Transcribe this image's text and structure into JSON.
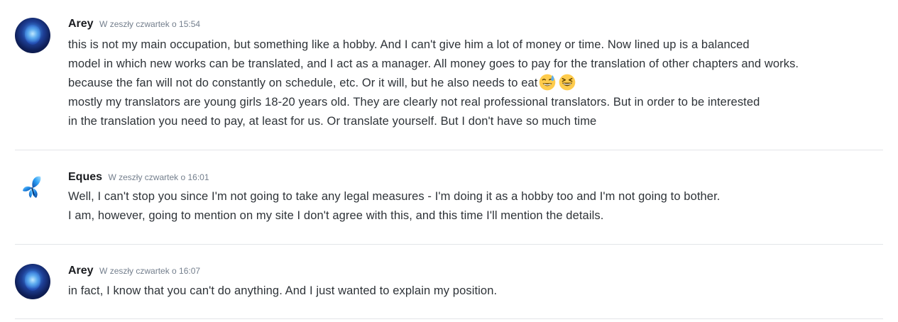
{
  "messages": [
    {
      "username": "Arey",
      "timestamp": "W zeszły czwartek o 15:54",
      "avatar_icon": "nebula-portrait-avatar",
      "lines": [
        "this is not my main occupation, but something like a hobby.  And I can't give him a lot of money or time.  Now lined up is a balanced",
        "model in which new works can be translated, and I act as a manager.  All money goes to pay for the translation of other chapters and works.",
        "because the fan will not do constantly on schedule, etc.  Or it will, but he also needs to eat",
        "mostly my translators are young girls 18-20 years old.  They are clearly not real professional translators.  But in order to be interested",
        "in the translation you need to pay, at least for us.  Or translate yourself.  But I don't have so much time"
      ],
      "emojis": [
        "sweat-smile-emoji",
        "laughing-emoji"
      ]
    },
    {
      "username": "Eques",
      "timestamp": "W zeszły czwartek o 16:01",
      "avatar_icon": "blue-butterfly-avatar",
      "lines": [
        "Well, I can't stop you since I'm not going to take any legal measures - I'm doing it as a hobby too and I'm not going to bother.",
        "I am, however, going to mention on my site I don't agree with this, and this time I'll mention the details."
      ]
    },
    {
      "username": "Arey",
      "timestamp": "W zeszły czwartek o 16:07",
      "avatar_icon": "nebula-portrait-avatar",
      "lines": [
        "in fact, I know that you can't do anything.  And I just wanted to explain my position."
      ]
    }
  ],
  "colors": {
    "username": "#1a1c20",
    "timestamp": "#747f8d",
    "text": "#2e3338",
    "divider": "#e3e5e8",
    "background": "#ffffff"
  }
}
